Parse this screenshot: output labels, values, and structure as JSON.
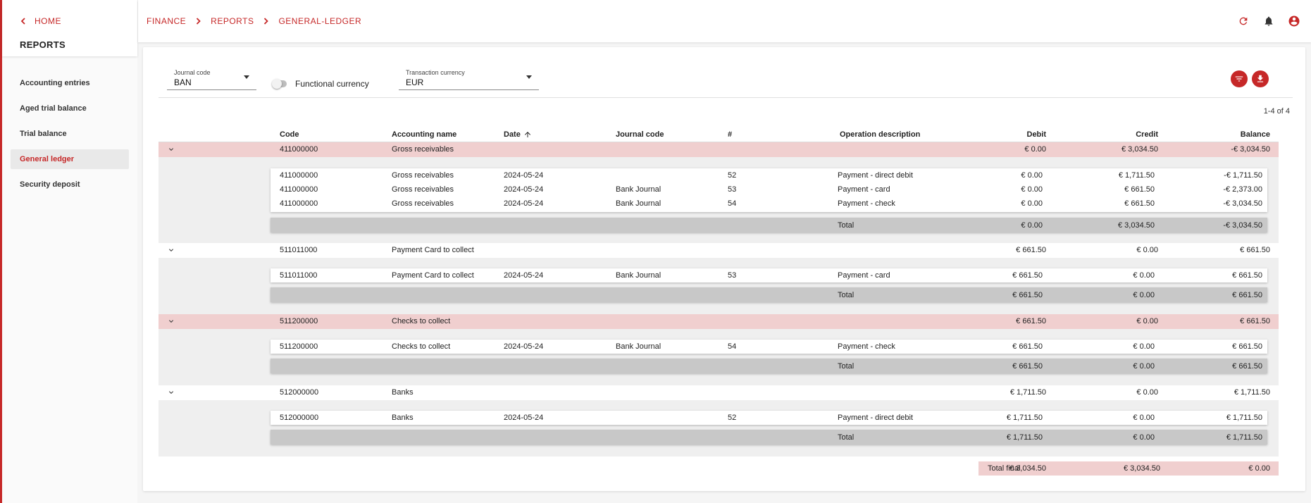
{
  "sidebar": {
    "home_label": "HOME",
    "title": "REPORTS",
    "items": [
      {
        "label": "Accounting entries"
      },
      {
        "label": "Aged trial balance"
      },
      {
        "label": "Trial balance"
      },
      {
        "label": "General ledger",
        "active": true
      },
      {
        "label": "Security deposit"
      }
    ]
  },
  "breadcrumb": [
    "FINANCE",
    "REPORTS",
    "GENERAL-LEDGER"
  ],
  "top_icons": [
    "refresh-icon",
    "bell-icon",
    "account-icon"
  ],
  "filters": {
    "journal_code": {
      "label": "Journal code",
      "value": "BAN"
    },
    "functional_currency": {
      "label": "Functional currency",
      "checked": false
    },
    "transaction_currency": {
      "label": "Transaction currency",
      "value": "EUR"
    }
  },
  "actions": [
    "filter-icon",
    "download-icon"
  ],
  "pagination": "1-4 of 4",
  "table": {
    "headers": {
      "code": "Code",
      "name": "Accounting name",
      "date": "Date",
      "journal": "Journal code",
      "num": "#",
      "desc": "Operation description",
      "debit": "Debit",
      "credit": "Credit",
      "balance": "Balance"
    },
    "groups": [
      {
        "code": "411000000",
        "name": "Gross receivables",
        "debit": "€ 0.00",
        "credit": "€ 3,034.50",
        "balance": "-€ 3,034.50",
        "rows": [
          {
            "code": "411000000",
            "name": "Gross receivables",
            "date": "2024-05-24",
            "journal": "",
            "num": "52",
            "desc": "Payment - direct debit",
            "debit": "€ 0.00",
            "credit": "€ 1,711.50",
            "balance": "-€ 1,711.50"
          },
          {
            "code": "411000000",
            "name": "Gross receivables",
            "date": "2024-05-24",
            "journal": "Bank Journal",
            "num": "53",
            "desc": "Payment - card",
            "debit": "€ 0.00",
            "credit": "€ 661.50",
            "balance": "-€ 2,373.00"
          },
          {
            "code": "411000000",
            "name": "Gross receivables",
            "date": "2024-05-24",
            "journal": "Bank Journal",
            "num": "54",
            "desc": "Payment - check",
            "debit": "€ 0.00",
            "credit": "€ 661.50",
            "balance": "-€ 3,034.50"
          }
        ],
        "total": {
          "label": "Total",
          "debit": "€ 0.00",
          "credit": "€ 3,034.50",
          "balance": "-€ 3,034.50"
        }
      },
      {
        "code": "511011000",
        "name": "Payment Card to collect",
        "debit": "€ 661.50",
        "credit": "€ 0.00",
        "balance": "€ 661.50",
        "rows": [
          {
            "code": "511011000",
            "name": "Payment Card to collect",
            "date": "2024-05-24",
            "journal": "Bank Journal",
            "num": "53",
            "desc": "Payment - card",
            "debit": "€ 661.50",
            "credit": "€ 0.00",
            "balance": "€ 661.50"
          }
        ],
        "total": {
          "label": "Total",
          "debit": "€ 661.50",
          "credit": "€ 0.00",
          "balance": "€ 661.50"
        }
      },
      {
        "code": "511200000",
        "name": "Checks to collect",
        "debit": "€ 661.50",
        "credit": "€ 0.00",
        "balance": "€ 661.50",
        "rows": [
          {
            "code": "511200000",
            "name": "Checks to collect",
            "date": "2024-05-24",
            "journal": "Bank Journal",
            "num": "54",
            "desc": "Payment - check",
            "debit": "€ 661.50",
            "credit": "€ 0.00",
            "balance": "€ 661.50"
          }
        ],
        "total": {
          "label": "Total",
          "debit": "€ 661.50",
          "credit": "€ 0.00",
          "balance": "€ 661.50"
        }
      },
      {
        "code": "512000000",
        "name": "Banks",
        "debit": "€ 1,711.50",
        "credit": "€ 0.00",
        "balance": "€ 1,711.50",
        "rows": [
          {
            "code": "512000000",
            "name": "Banks",
            "date": "2024-05-24",
            "journal": "",
            "num": "52",
            "desc": "Payment - direct debit",
            "debit": "€ 1,711.50",
            "credit": "€ 0.00",
            "balance": "€ 1,711.50"
          }
        ],
        "total": {
          "label": "Total",
          "debit": "€ 1,711.50",
          "credit": "€ 0.00",
          "balance": "€ 1,711.50"
        }
      }
    ],
    "final": {
      "label": "Total final",
      "debit": "€ 3,034.50",
      "credit": "€ 3,034.50",
      "balance": "€ 0.00"
    }
  },
  "colors": {
    "accent": "#c62828",
    "highlight": "#f0cfcf",
    "total_row": "#c8c8c8"
  }
}
